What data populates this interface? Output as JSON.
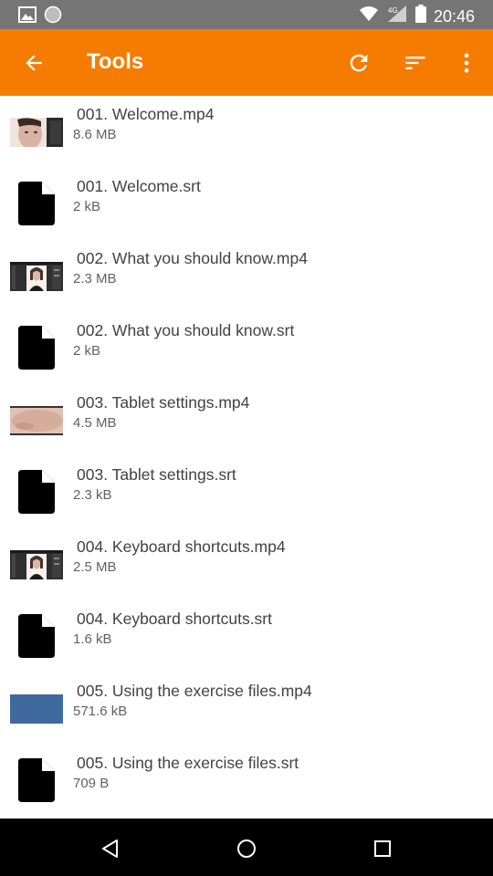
{
  "status_bar": {
    "time": "20:46",
    "network_label": "4G",
    "icons": [
      "image-icon",
      "circle-icon",
      "wifi-icon",
      "signal-icon",
      "battery-icon"
    ]
  },
  "app_bar": {
    "title": "Tools",
    "background": "#f57c00",
    "icons": [
      "back-arrow-icon",
      "refresh-icon",
      "sort-icon",
      "more-vert-icon"
    ]
  },
  "files": [
    {
      "name": " 001. Welcome.mp4",
      "size": "8.6 MB",
      "type": "video",
      "thumb": "face"
    },
    {
      "name": " 001. Welcome.srt",
      "size": "2 kB",
      "type": "document"
    },
    {
      "name": " 002. What you should know.mp4",
      "size": "2.3 MB",
      "type": "video",
      "thumb": "editor"
    },
    {
      "name": " 002. What you should know.srt",
      "size": "2 kB",
      "type": "document"
    },
    {
      "name": " 003. Tablet settings.mp4",
      "size": "4.5 MB",
      "type": "video",
      "thumb": "skin"
    },
    {
      "name": " 003. Tablet settings.srt",
      "size": "2.3 kB",
      "type": "document"
    },
    {
      "name": " 004. Keyboard shortcuts.mp4",
      "size": "2.5 MB",
      "type": "video",
      "thumb": "editor"
    },
    {
      "name": " 004. Keyboard shortcuts.srt",
      "size": "1.6 kB",
      "type": "document"
    },
    {
      "name": " 005. Using the exercise files.mp4",
      "size": "571.6 kB",
      "type": "video",
      "thumb": "blue"
    },
    {
      "name": " 005. Using the exercise files.srt",
      "size": "709 B",
      "type": "document"
    }
  ],
  "nav_bar": {
    "icons": [
      "back-triangle-icon",
      "home-circle-icon",
      "recents-square-icon"
    ]
  }
}
